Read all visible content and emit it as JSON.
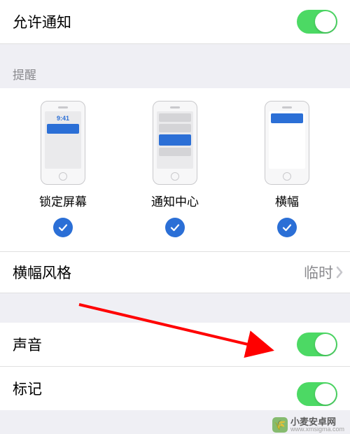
{
  "allowNotifications": {
    "label": "允许通知",
    "enabled": true
  },
  "alertsHeader": "提醒",
  "alerts": {
    "lockScreen": {
      "label": "锁定屏幕",
      "time": "9:41",
      "checked": true
    },
    "notificationCenter": {
      "label": "通知中心",
      "checked": true
    },
    "banner": {
      "label": "横幅",
      "checked": true
    }
  },
  "bannerStyle": {
    "label": "横幅风格",
    "value": "临时"
  },
  "sound": {
    "label": "声音",
    "enabled": true
  },
  "badges": {
    "label": "标记",
    "enabled": true
  },
  "watermark": {
    "name": "小麦安卓网",
    "url": "www.xmsigma.com"
  }
}
